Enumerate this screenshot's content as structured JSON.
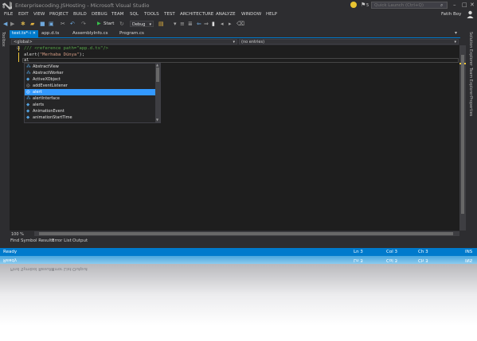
{
  "title_bar": {
    "title": "Enterprisecoding.JSHosting - Microsoft Visual Studio",
    "notification_count": "5",
    "quick_launch_placeholder": "Quick Launch (Ctrl+Q)"
  },
  "menu": [
    "FILE",
    "EDIT",
    "VIEW",
    "PROJECT",
    "BUILD",
    "DEBUG",
    "TEAM",
    "SQL",
    "TOOLS",
    "TEST",
    "ARCHITECTURE",
    "ANALYZE",
    "WINDOW",
    "HELP"
  ],
  "user": {
    "name": "Fatih Boy"
  },
  "toolbar": {
    "start_label": "Start",
    "configuration": "Debug"
  },
  "left_strip": {
    "toolbox": "Toolbox"
  },
  "tabs": [
    {
      "label": "test.ts*",
      "active": true
    },
    {
      "label": "app.d.ts",
      "active": false
    },
    {
      "label": "AssemblyInfo.cs",
      "active": false
    },
    {
      "label": "Program.cs",
      "active": false
    }
  ],
  "nav": {
    "scope": "<global>",
    "members": "(no entries)"
  },
  "code": {
    "line1": "/// <reference path=\"app.d.ts\"/>",
    "line2_prefix": "alert(",
    "line2_string": "\"Merhaba Dünya\"",
    "line2_suffix": ");",
    "line3": "al"
  },
  "completion": {
    "items": [
      {
        "label": "AbstractView",
        "icon": "type-icon"
      },
      {
        "label": "AbstractWorker",
        "icon": "type-icon"
      },
      {
        "label": "ActiveXObject",
        "icon": "object-icon"
      },
      {
        "label": "addEventListener",
        "icon": "method-icon"
      },
      {
        "label": "alert",
        "icon": "method-icon",
        "selected": true
      },
      {
        "label": "alertInterface",
        "icon": "interface-icon"
      },
      {
        "label": "alerts",
        "icon": "object-icon"
      },
      {
        "label": "AnimationEvent",
        "icon": "object-icon"
      },
      {
        "label": "animationStartTime",
        "icon": "field-icon"
      }
    ]
  },
  "editor": {
    "zoom": "100 %"
  },
  "right_strip": [
    "Solution Explorer",
    "Team Explorer",
    "Properties"
  ],
  "bottom_tabs": [
    "Find Symbol Results",
    "Error List",
    "Output"
  ],
  "status": {
    "state": "Ready",
    "line": "Ln 3",
    "col": "Col 3",
    "ch": "Ch 3",
    "mode": "INS"
  },
  "colors": {
    "accent": "#007acc",
    "selection": "#3399ff",
    "background": "#2d2d30",
    "editor": "#1e1e1e",
    "comment": "#57a64a",
    "string": "#d69d85"
  }
}
